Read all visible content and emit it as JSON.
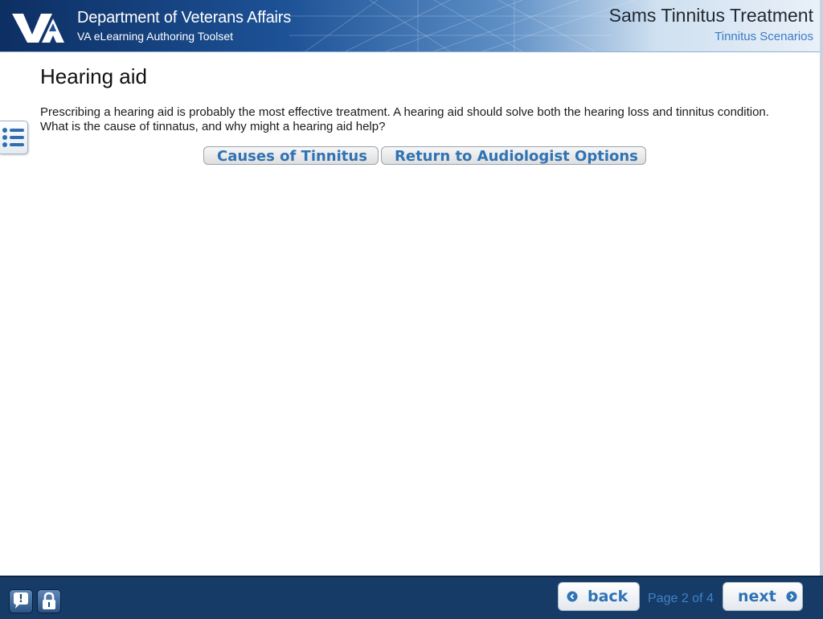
{
  "header": {
    "org_title": "Department of Veterans Affairs",
    "toolset_title": "VA eLearning Authoring Toolset",
    "course_title": "Sams Tinnitus Treatment",
    "course_subtitle": "Tinnitus Scenarios",
    "logo_icon": "va-logo-icon"
  },
  "content": {
    "heading": "Hearing aid",
    "body": "Prescribing a hearing aid is probably the most effective treatment.  A hearing aid should solve both the hearing loss and tinnitus condition.  What is the cause of tinnatus, and why might a hearing aid help?",
    "buttons": [
      {
        "label": "Causes of Tinnitus"
      },
      {
        "label": "Return to Audiologist Options"
      }
    ]
  },
  "side_menu": {
    "icon": "list-menu-icon"
  },
  "footer": {
    "help_icon": "help-icon",
    "lock_icon": "lock-icon",
    "back_label": "back",
    "next_label": "next",
    "page_indicator": "Page 2 of 4"
  },
  "colors": {
    "header_dark": "#0d2f63",
    "footer_bg": "#163b67",
    "accent_blue": "#2f73b5",
    "link_blue": "#3a7bc6"
  }
}
